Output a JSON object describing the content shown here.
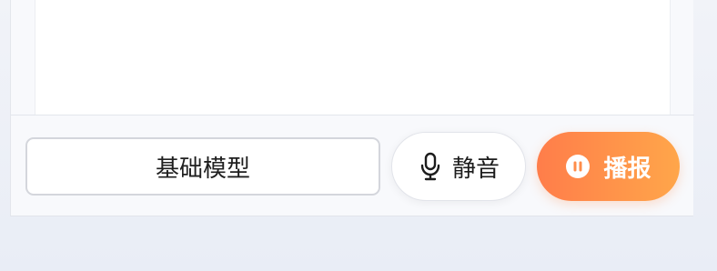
{
  "toolbar": {
    "model_select": {
      "label": "基础模型"
    },
    "mute_button": {
      "label": "静音",
      "icon": "microphone-icon"
    },
    "broadcast_button": {
      "label": "播报",
      "icon": "pause-icon"
    }
  },
  "colors": {
    "accent_start": "#ff7d4a",
    "accent_end": "#ffa64a"
  }
}
